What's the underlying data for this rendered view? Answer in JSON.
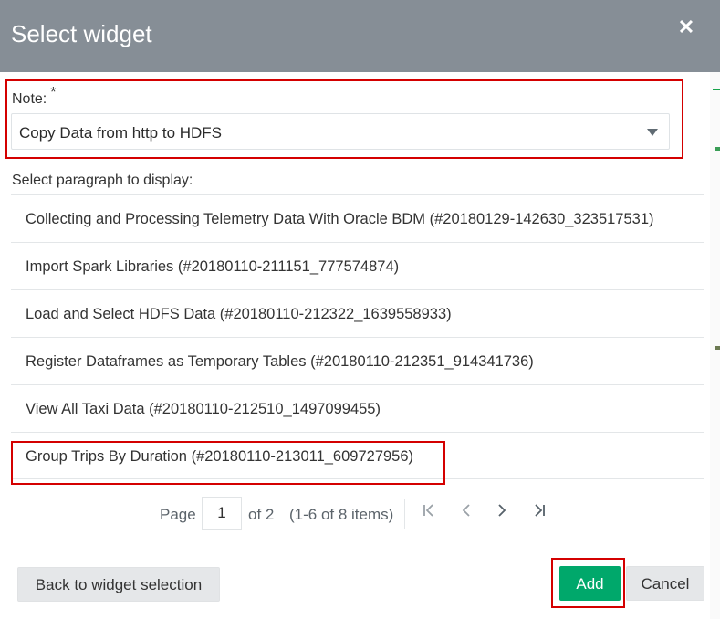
{
  "dialog": {
    "title": "Select widget",
    "close_icon": "close-icon",
    "close_symbol": "✕"
  },
  "note": {
    "label": "Note:",
    "required_mark": "*",
    "selected": "Copy Data from http to HDFS",
    "caret_icon": "caret-down-icon"
  },
  "paragraphs": {
    "label": "Select paragraph to display:",
    "items": [
      "Collecting and Processing Telemetry Data With Oracle BDM (#20180129-142630_323517531)",
      "Import Spark Libraries (#20180110-211151_777574874)",
      "Load and Select HDFS Data (#20180110-212322_1639558933)",
      "Register Dataframes as Temporary Tables (#20180110-212351_914341736)",
      "View All Taxi Data (#20180110-212510_1497099455)",
      "Group Trips By Duration (#20180110-213011_609727956)"
    ],
    "highlighted_index": 5
  },
  "pager": {
    "page_word": "Page",
    "current_page": "1",
    "of_text": "of 2",
    "items_text": "(1-6 of 8 items)",
    "first_symbol": "K",
    "prev_symbol": "‹",
    "next_symbol": "›",
    "last_symbol": "›|"
  },
  "footer": {
    "back_label": "Back to widget selection",
    "add_label": "Add",
    "cancel_label": "Cancel"
  },
  "colors": {
    "header": "#868e96",
    "primary": "#00a86b",
    "highlight": "#d40000"
  }
}
